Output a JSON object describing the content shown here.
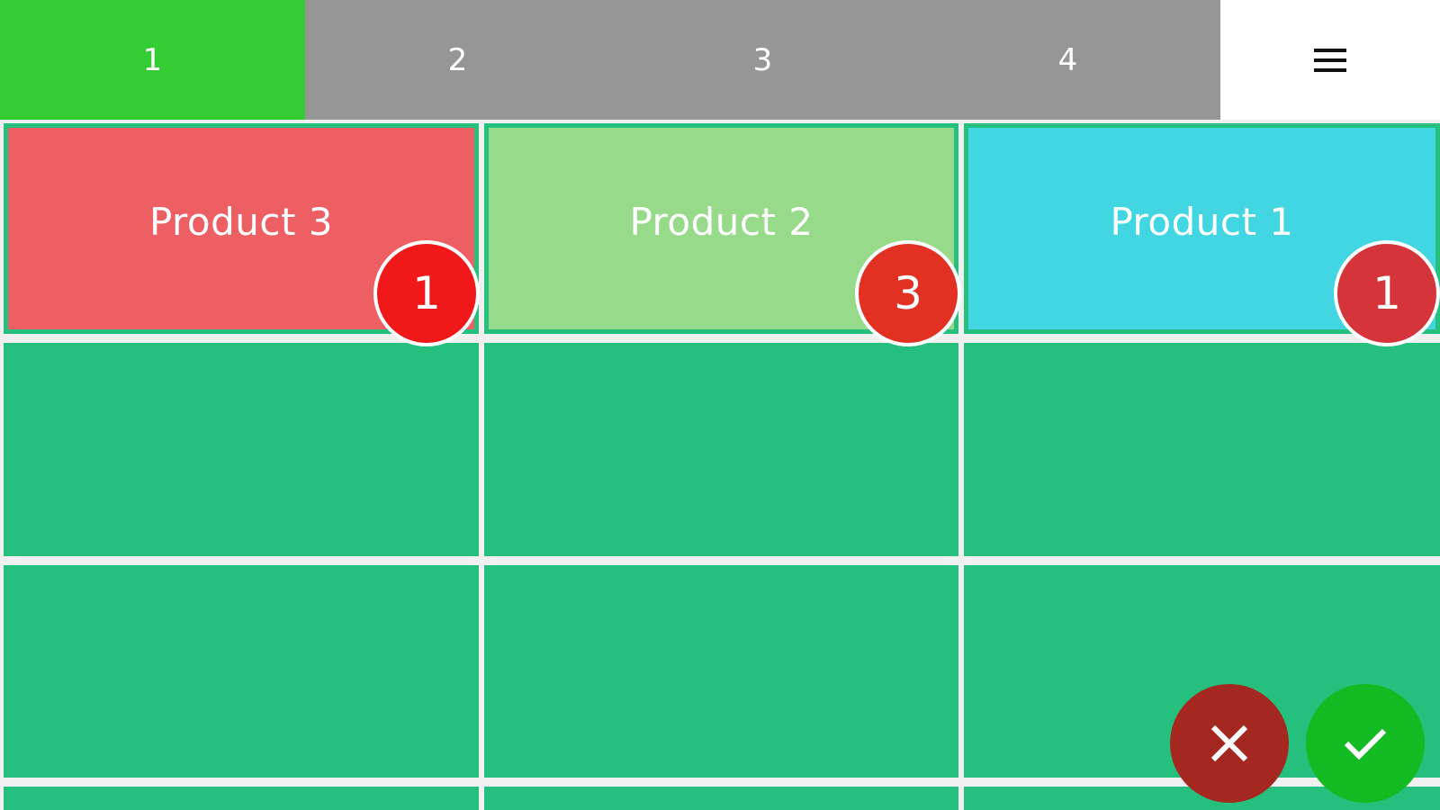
{
  "tabs": [
    {
      "label": "1",
      "active": true
    },
    {
      "label": "2",
      "active": false
    },
    {
      "label": "3",
      "active": false
    },
    {
      "label": "4",
      "active": false
    }
  ],
  "menu": {
    "icon": "hamburger-menu-icon"
  },
  "products": [
    {
      "name": "Product 3",
      "count": "1",
      "color": "#ee5f64",
      "badge_color": "#f01818"
    },
    {
      "name": "Product 2",
      "count": "3",
      "color": "#97da8a",
      "badge_color": "#e23122"
    },
    {
      "name": "Product 1",
      "count": "1",
      "color": "#42d6e2",
      "badge_color": "#d4343a"
    }
  ],
  "colors": {
    "empty_cell": "#25c07e",
    "tab_active": "#33cc33",
    "tab_inactive": "#969696",
    "cancel": "#a52820",
    "confirm": "#13bb22"
  },
  "actions": {
    "cancel_icon": "close-icon",
    "confirm_icon": "check-icon"
  }
}
